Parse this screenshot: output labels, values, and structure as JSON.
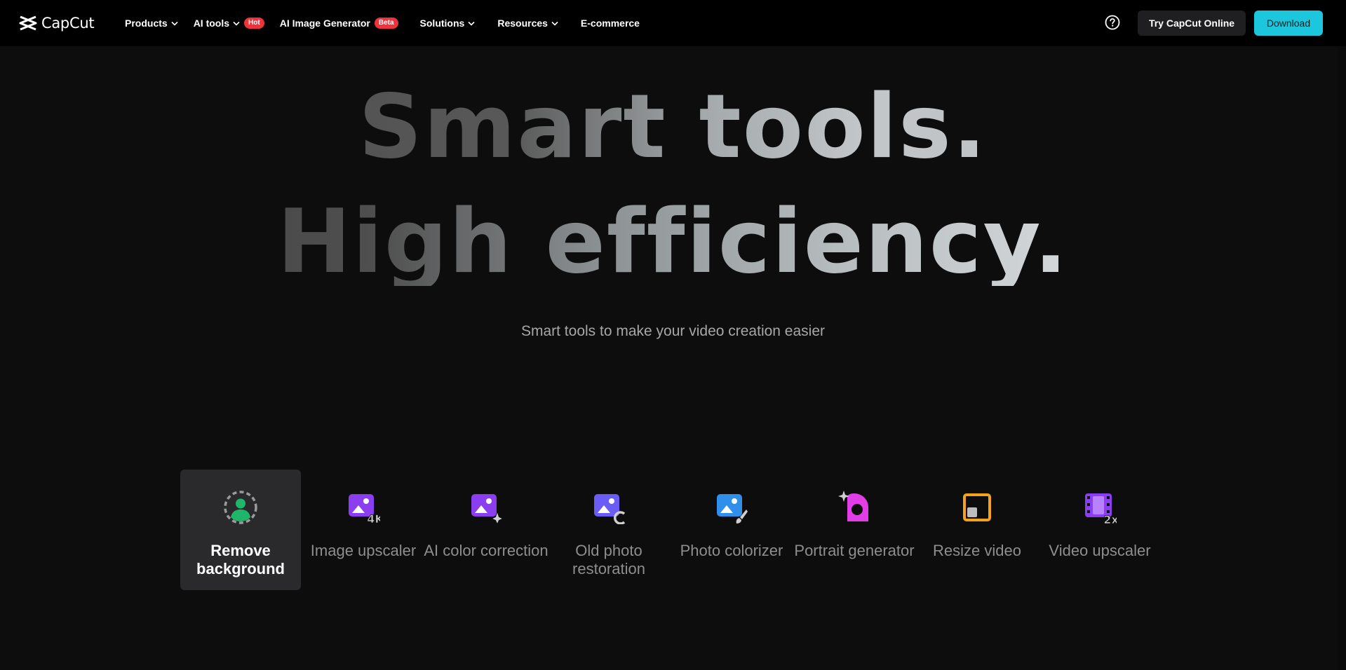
{
  "header": {
    "logo_text": "CapCut",
    "nav": [
      {
        "label": "Products",
        "has_dropdown": true
      },
      {
        "label": "AI tools",
        "has_dropdown": true,
        "badge": "Hot"
      },
      {
        "label": "AI Image Generator",
        "has_dropdown": false,
        "badge": "Beta"
      },
      {
        "label": "Solutions",
        "has_dropdown": true
      },
      {
        "label": "Resources",
        "has_dropdown": true
      },
      {
        "label": "E-commerce",
        "has_dropdown": false
      }
    ],
    "help_icon": "question-circle-icon",
    "try_button": "Try CapCut Online",
    "download_button": "Download"
  },
  "hero": {
    "line1": "Smart tools.",
    "line2": "High efficiency.",
    "subtitle": "Smart tools to make your video creation easier"
  },
  "tools": [
    {
      "label": "Remove background",
      "icon": "remove-background-icon",
      "active": true
    },
    {
      "label": "Image upscaler",
      "icon": "image-upscaler-4k-icon",
      "active": false
    },
    {
      "label": "AI color correction",
      "icon": "ai-color-correction-icon",
      "active": false
    },
    {
      "label": "Old photo restoration",
      "icon": "old-photo-restoration-icon",
      "active": false
    },
    {
      "label": "Photo colorizer",
      "icon": "photo-colorizer-icon",
      "active": false
    },
    {
      "label": "Portrait generator",
      "icon": "portrait-generator-icon",
      "active": false
    },
    {
      "label": "Resize video",
      "icon": "resize-video-icon",
      "active": false
    },
    {
      "label": "Video upscaler",
      "icon": "video-upscaler-2x-icon",
      "active": false
    }
  ],
  "colors": {
    "page_bg": "#0d0d0e",
    "nav_bg": "#000000",
    "accent": "#1cc6dc",
    "badge": "#f0323c",
    "active_tool_bg": "#2a2a2c"
  }
}
